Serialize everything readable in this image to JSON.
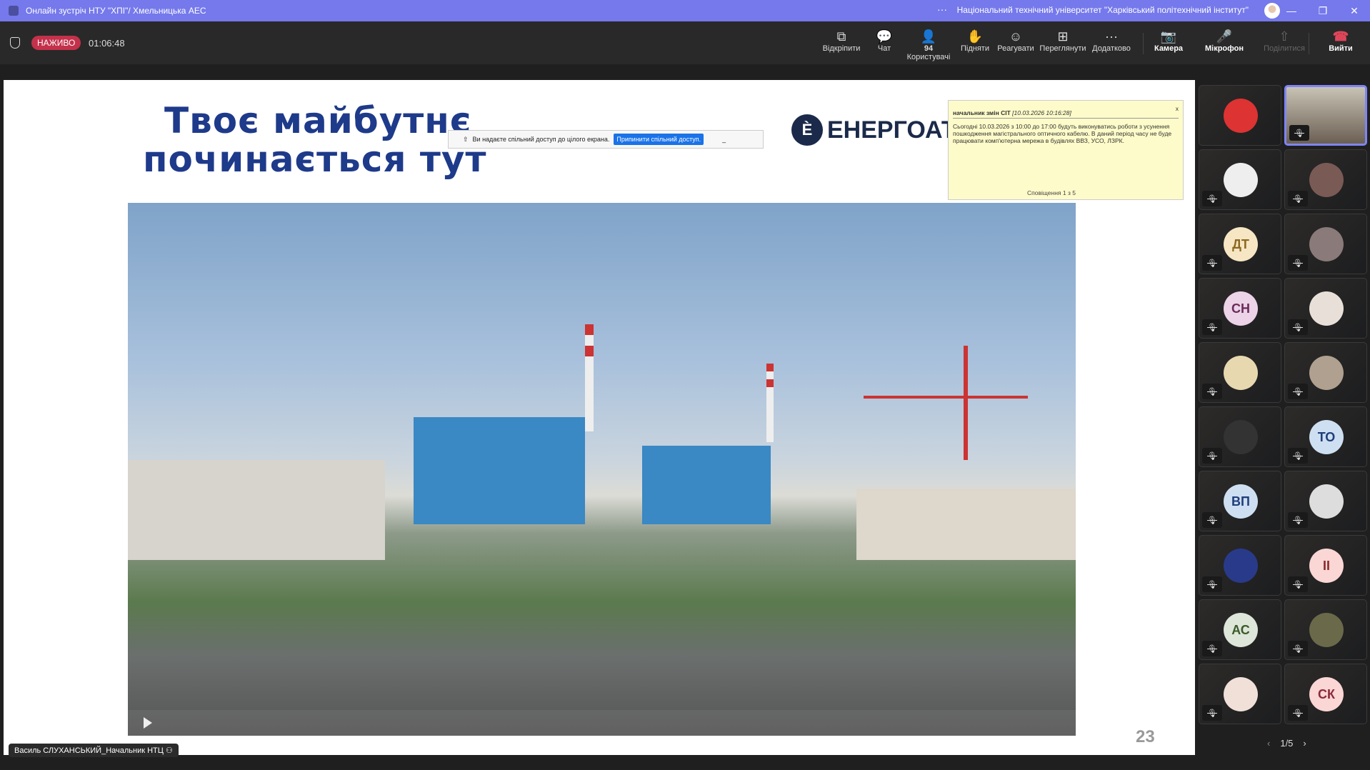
{
  "titlebar": {
    "title": "Онлайн зустріч НТУ \"ХПІ\"/ Хмельницька АЕС",
    "org": "Національний технічний університет \"Харківський політехнічний інститут\"",
    "more": "···"
  },
  "toolbar": {
    "live": "НАЖИВО",
    "timer": "01:06:48",
    "buttons": [
      {
        "label": "Відкріпити",
        "icon": "⧉"
      },
      {
        "label": "Чат",
        "icon": "💬"
      },
      {
        "label": "Користувачі",
        "icon": "👤",
        "count": "94"
      },
      {
        "label": "Підняти",
        "icon": "✋"
      },
      {
        "label": "Реагувати",
        "icon": "☺"
      },
      {
        "label": "Переглянути",
        "icon": "⊞"
      },
      {
        "label": "Додатково",
        "icon": "···"
      },
      {
        "label": "Камера",
        "icon": "📷"
      },
      {
        "label": "Мікрофон",
        "icon": "🎤"
      },
      {
        "label": "Поділитися",
        "icon": "⇧"
      },
      {
        "label": "Вийти",
        "icon": "☎"
      }
    ]
  },
  "slide": {
    "headline1": "Твоє майбутнє",
    "headline2": "починається тут",
    "logo": "ЕНЕРГОАТОМ",
    "page": "23"
  },
  "sharebar": {
    "text": "Ви надаєте спільний доступ до цілого екрана.",
    "stop": "Припинити спільний доступ.",
    "min": "_"
  },
  "notification": {
    "sender": "начальник змін СІТ",
    "time": "[10.03.2026 10:16:28]",
    "body": "Сьогодні 10.03.2026 з 10:00 до 17:00 будуть виконуватись роботи з усунення пошкодження магістрального оптичного кабелю. В даний період часу не буде працювати комп'ютерна мережа в будівлях ВВЗ, УСО, ЛЗРК.",
    "footer": "Сповіщення 1 з 5",
    "close": "x"
  },
  "presenter": {
    "name": "Василь СЛУХАНСЬКИЙ_Начальник НТЦ"
  },
  "participants": [
    {
      "initials": "",
      "bg": "#d33",
      "active": false
    },
    {
      "initials": "",
      "active": true
    },
    {
      "initials": "",
      "bg": "#eee"
    },
    {
      "initials": "",
      "bg": "#7a5a55"
    },
    {
      "initials": "ДТ",
      "bg": "#f7e6c4",
      "fg": "#8a6a20"
    },
    {
      "initials": "",
      "bg": "#8a7a7a"
    },
    {
      "initials": "СН",
      "bg": "#ecd3e8",
      "fg": "#6a2a5a"
    },
    {
      "initials": "",
      "bg": "#e8e0d8"
    },
    {
      "initials": "",
      "bg": "#e8d8b0"
    },
    {
      "initials": "",
      "bg": "#b0a090"
    },
    {
      "initials": "",
      "bg": "#333"
    },
    {
      "initials": "ТО",
      "bg": "#cfdff2",
      "fg": "#1f3f7a"
    },
    {
      "initials": "ВП",
      "bg": "#cfdff2",
      "fg": "#1f3f7a"
    },
    {
      "initials": "",
      "bg": "#ddd"
    },
    {
      "initials": "",
      "bg": "#2a3a8a"
    },
    {
      "initials": "ІІ",
      "bg": "#fad6d4",
      "fg": "#8a2a2a"
    },
    {
      "initials": "АС",
      "bg": "#dde6d8",
      "fg": "#3a5a2a"
    },
    {
      "initials": "",
      "bg": "#6a6a4a"
    },
    {
      "initials": "",
      "bg": "#f0e0d8"
    },
    {
      "initials": "СК",
      "bg": "#fad6d4",
      "fg": "#8a2a3a"
    }
  ],
  "pager": {
    "prev": "‹",
    "label": "1/5",
    "next": "›"
  },
  "colors": {
    "titlebar": "#7579eb",
    "live": "#c4314b",
    "active_tile": "#7f85f5"
  }
}
